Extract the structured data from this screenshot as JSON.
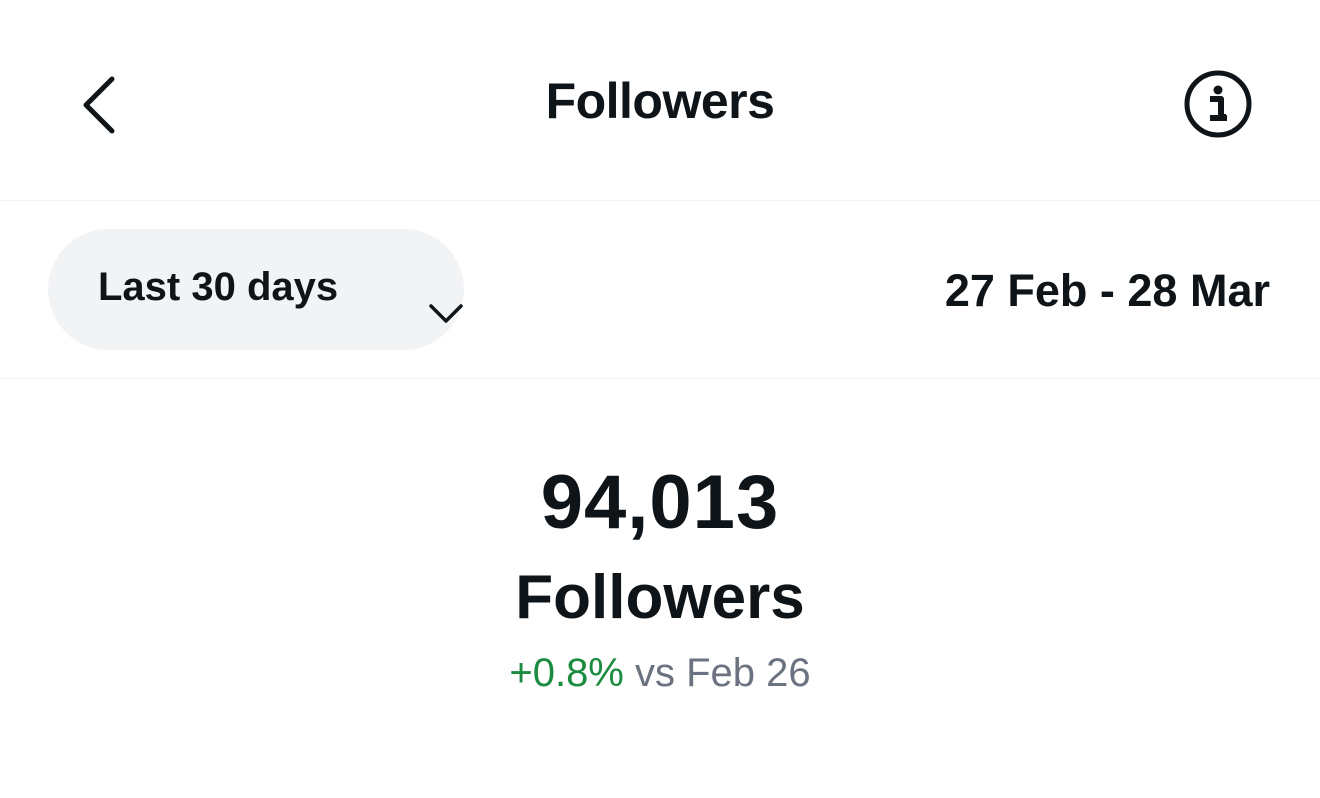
{
  "header": {
    "title": "Followers",
    "back_icon": "chevron-left-icon",
    "info_icon": "info-circle-icon"
  },
  "filter": {
    "range_label": "Last 30 days",
    "range_icon": "chevron-down-icon",
    "date_range": "27 Feb - 28 Mar"
  },
  "stats": {
    "count": "94,013",
    "label": "Followers",
    "change_percent": "+0.8%",
    "change_comparison": "vs Feb 26"
  },
  "colors": {
    "text_primary": "#0f1419",
    "positive": "#1a8b3f",
    "secondary": "#6b7280",
    "pill_bg": "#f2f3f5",
    "divider": "#eff3f4"
  }
}
